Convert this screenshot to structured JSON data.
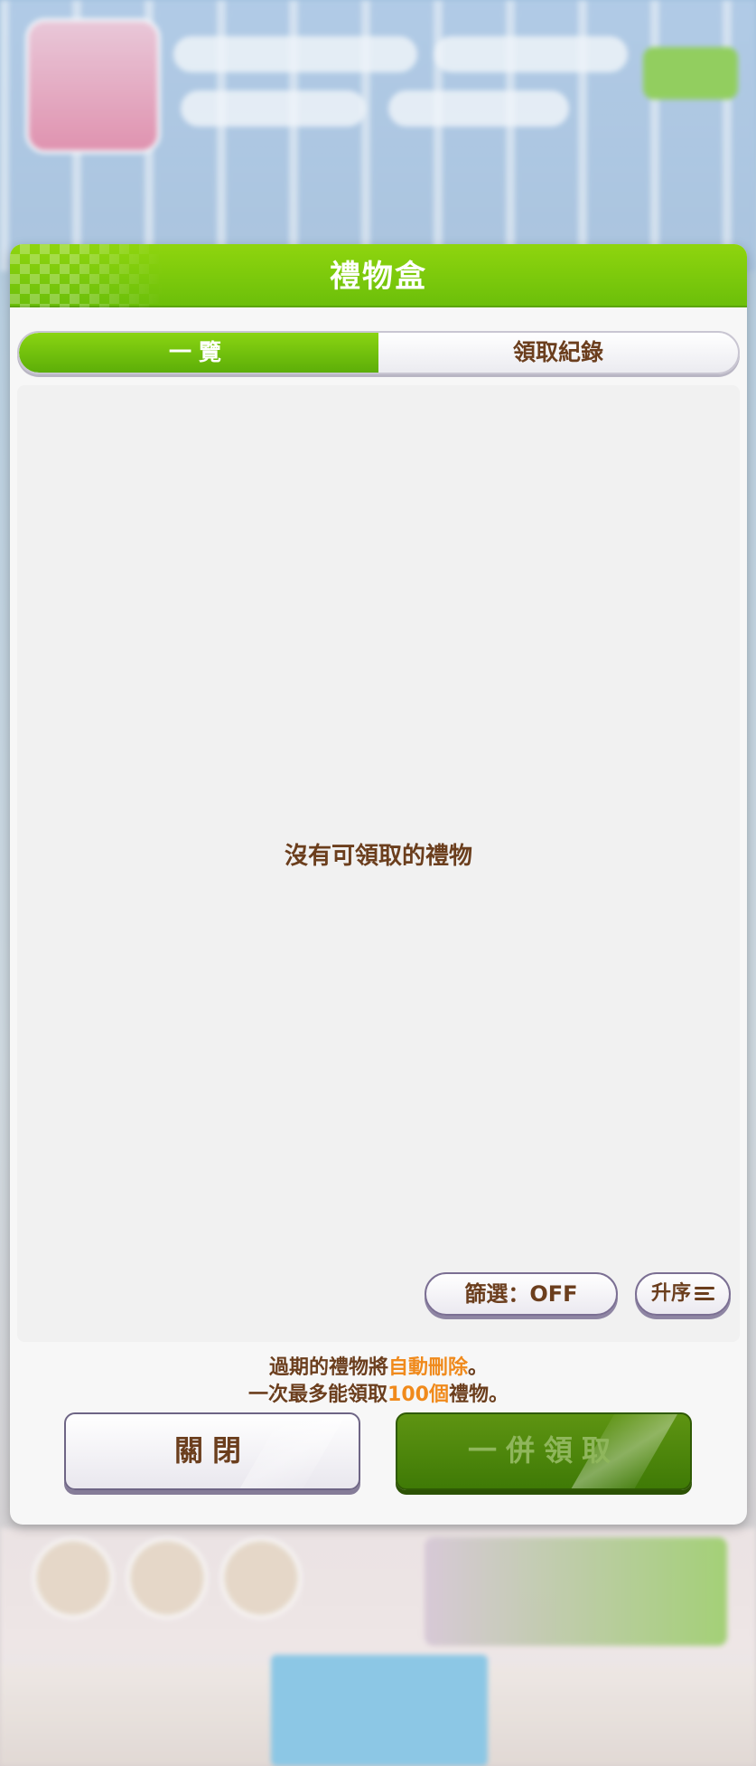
{
  "dialog": {
    "title": "禮物盒",
    "tabs": [
      {
        "label": "一覽",
        "active": true
      },
      {
        "label": "領取紀錄",
        "active": false
      }
    ],
    "empty_message": "沒有可領取的禮物",
    "filter_label": "篩選：OFF",
    "sort_label": "升序",
    "notes": {
      "line1_prefix": "過期的禮物將",
      "line1_highlight": "自動刪除",
      "line1_suffix": "。",
      "line2_prefix": "一次最多能領取",
      "line2_highlight": "100個",
      "line2_suffix": "禮物。"
    },
    "close_button": "關閉",
    "claim_all_button": "一併領取",
    "claim_all_enabled": false
  },
  "colors": {
    "header_green": "#7cc80c",
    "text_brown": "#6b3e1d",
    "highlight_orange": "#f08a1c",
    "claim_button_green": "#4a8509"
  },
  "icons": {
    "sort": "sort-lines-icon"
  }
}
